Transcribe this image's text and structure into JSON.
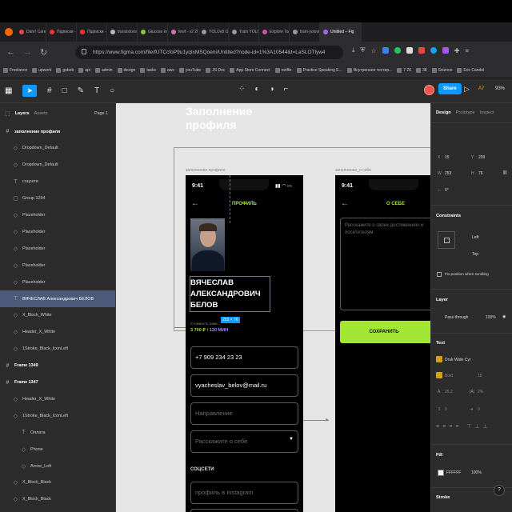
{
  "browser": {
    "tabs": [
      {
        "label": "Dare! Care - Th",
        "color": "#e44"
      },
      {
        "label": "Підписки - You",
        "color": "#f33"
      },
      {
        "label": "Підписки - You",
        "color": "#f33"
      },
      {
        "label": "transistorsoft/",
        "color": "#bbb"
      },
      {
        "label": "Glucose Insight",
        "color": "#8c3"
      },
      {
        "label": "fewf - v2 2023",
        "color": "#c7a"
      },
      {
        "label": "YOLOv8 Object",
        "color": "#999"
      },
      {
        "label": "Train YOLOv8",
        "color": "#999"
      },
      {
        "label": "Explore Top Co",
        "color": "#c5a"
      },
      {
        "label": "train-yolov8-cu",
        "color": "#999"
      },
      {
        "label": "Untitled – Fig",
        "color": "#a6f"
      }
    ],
    "url": "https://www.figma.com/file/fUTCcfoP9u1yqIxMSQoeni/Untitled?node-id=1%3A10544&t=LaSLOTlyw4",
    "bookmarks": [
      "Freelance",
      "upwork",
      "gobeb",
      "api",
      "admin",
      "design",
      "tasks",
      "aws",
      "youTube",
      "JS Doc",
      "App Store Connect",
      "netflix",
      "Practice Speaking E...",
      "Внутреннее тестир...",
      "7 26",
      "38",
      "Science",
      "Eric Candel"
    ]
  },
  "toolbar": {
    "share": "Share",
    "zoom": "93%",
    "avatar_initials": "A7"
  },
  "layers_panel": {
    "tab_layers": "Layers",
    "tab_assets": "Assets",
    "page": "Page 1",
    "items": [
      {
        "icon": "#",
        "label": "заполнение профиля",
        "frame": true,
        "indent": 0
      },
      {
        "icon": "◇",
        "label": "Dropdown_Default",
        "frame": false,
        "indent": 1
      },
      {
        "icon": "◇",
        "label": "Dropdown_Default",
        "frame": false,
        "indent": 1
      },
      {
        "icon": "T",
        "label": "соцсети",
        "frame": false,
        "indent": 1
      },
      {
        "icon": "▢",
        "label": "Group 1294",
        "frame": false,
        "indent": 1
      },
      {
        "icon": "◇",
        "label": "Placeholder",
        "frame": false,
        "indent": 1
      },
      {
        "icon": "◇",
        "label": "Placeholder",
        "frame": false,
        "indent": 1
      },
      {
        "icon": "◇",
        "label": "Placeholder",
        "frame": false,
        "indent": 1
      },
      {
        "icon": "◇",
        "label": "Placeholder",
        "frame": false,
        "indent": 1
      },
      {
        "icon": "◇",
        "label": "Placeholder",
        "frame": false,
        "indent": 1
      },
      {
        "icon": "T",
        "label": "ВЯЧЕСЛАВ Александрович БЕЛОВ",
        "frame": false,
        "indent": 1,
        "selected": true
      },
      {
        "icon": "◇",
        "label": "X_Block_White",
        "frame": false,
        "indent": 1
      },
      {
        "icon": "◇",
        "label": "Header_X_White",
        "frame": false,
        "indent": 1
      },
      {
        "icon": "◇",
        "label": "1Stroke_Black_IconLeft",
        "frame": false,
        "indent": 1
      },
      {
        "icon": "#",
        "label": "Frame 1349",
        "frame": true,
        "indent": 0
      },
      {
        "icon": "#",
        "label": "Frame 1347",
        "frame": true,
        "indent": 0
      },
      {
        "icon": "◇",
        "label": "Header_X_White",
        "frame": false,
        "indent": 1
      },
      {
        "icon": "◇",
        "label": "1Stroke_Black_IconLeft",
        "frame": false,
        "indent": 1
      },
      {
        "icon": "T",
        "label": "Оплата",
        "frame": false,
        "indent": 2
      },
      {
        "icon": "◇",
        "label": "Phone",
        "frame": false,
        "indent": 2
      },
      {
        "icon": "◇",
        "label": "Arrow_Left",
        "frame": false,
        "indent": 2
      },
      {
        "icon": "◇",
        "label": "X_Block_Black",
        "frame": false,
        "indent": 1
      },
      {
        "icon": "◇",
        "label": "X_Block_Black",
        "frame": false,
        "indent": 1
      }
    ]
  },
  "canvas": {
    "title": "Заполнение профиля",
    "frame1_label": "заполнение профиля",
    "frame2_label": "заполнение_о себе",
    "selection_size": "253 × 76",
    "phone1": {
      "time": "9:41",
      "header": "ПРОФИЛЬ",
      "name": "ВЯЧЕСЛАВ АЛЕКСАНДРОВИЧ БЕЛОВ",
      "price_label": "Стоимость грим...",
      "price": "3 700 ₽",
      "duration": "/ 120 МИН",
      "fields": [
        {
          "value": "+7 909 234 23 23",
          "placeholder": false
        },
        {
          "value": "vyacheslav_belov@mail.ru",
          "placeholder": false
        },
        {
          "value": "Направление",
          "placeholder": true
        },
        {
          "value": "Расскажите о себе",
          "placeholder": true,
          "dropdown": true
        }
      ],
      "social_heading": "СОЦСЕТИ",
      "social_field": "профиль в Instagram"
    },
    "phone2": {
      "time": "9:41",
      "header": "О СЕБЕ",
      "textarea_placeholder": "Расскажите о своих достижениях и посетителям",
      "save_button": "СОХРАНИТЬ"
    }
  },
  "design_panel": {
    "tabs": [
      "Design",
      "Prototype",
      "Inspect"
    ],
    "x": "15",
    "y": "209",
    "w": "253",
    "h": "76",
    "rotation": "0°",
    "constraints": {
      "title": "Constraints",
      "horizontal": "Left",
      "vertical": "Top"
    },
    "fix_position": "Fix position when scrolling",
    "layer": {
      "title": "Layer",
      "blend": "Pass through",
      "opacity": "100%"
    },
    "text": {
      "title": "Text",
      "font": "Druk Wide Cyr",
      "weight": "Bold",
      "size": "18",
      "line_height": "25,2",
      "letter_spacing": "2%",
      "para": "0",
      "para2": "0"
    },
    "fill": {
      "title": "Fill",
      "hex": "FFFFFF",
      "opacity": "100%"
    },
    "stroke": {
      "title": "Stroke"
    }
  },
  "colors": {
    "accent_green": "#a3e635",
    "figma_blue": "#0d99ff",
    "selection": "#4b5a78"
  }
}
